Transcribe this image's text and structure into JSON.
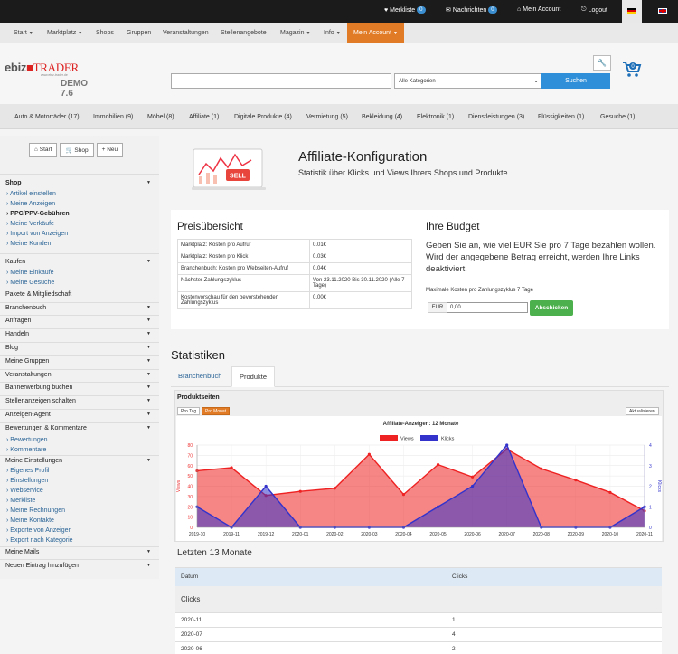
{
  "topbar": {
    "merkliste": "Merkliste",
    "merkliste_count": "0",
    "nachrichten": "Nachrichten",
    "nachrichten_count": "0",
    "account": "Mein Account",
    "logout": "Logout"
  },
  "nav": {
    "items": [
      "Start",
      "Marktplatz",
      "Shops",
      "Gruppen",
      "Veranstaltungen",
      "Stellenangebote",
      "Magazin",
      "Info"
    ],
    "active": "Mein Account"
  },
  "logo": {
    "brand1": "ebiz",
    "brand2": "TRADER",
    "url": "www.ebiz-trader.de",
    "demo": "DEMO 7.6"
  },
  "search": {
    "placeholder": "",
    "category": "Alle Kategorien",
    "button": "Suchen"
  },
  "categories": [
    "Auto & Motorräder (17)",
    "Immobilien (9)",
    "Möbel (8)",
    "Affiliate (1)",
    "Digitale Produkte (4)",
    "Vermietung (5)",
    "Bekleidung (4)",
    "Elektronik (1)",
    "Dienstleistungen (3)",
    "Flüssigkeiten (1)",
    "Gesuche (1)"
  ],
  "sidebar": {
    "buttons": {
      "start": "Start",
      "shop": "Shop",
      "neu": "Neu"
    },
    "shop": "Shop",
    "shop_links": [
      "Artikel einstellen",
      "Meine Anzeigen",
      "PPC/PPV-Gebühren",
      "Meine Verkäufe",
      "Import von Anzeigen",
      "Meine Kunden"
    ],
    "kaufen": "Kaufen",
    "kaufen_links": [
      "Meine Einkäufe",
      "Meine Gesuche"
    ],
    "sections1": [
      "Pakete & Mitgliedschaft",
      "Branchenbuch",
      "Anfragen",
      "Handeln",
      "Blog",
      "Meine Gruppen",
      "Veranstaltungen",
      "Bannerwerbung buchen",
      "Stellenanzeigen schalten",
      "Anzeigen-Agent",
      "Bewertungen & Kommentare"
    ],
    "bewertungen_links": [
      "Bewertungen",
      "Kommentare"
    ],
    "einstellungen": "Meine Einstellungen",
    "einstellungen_links": [
      "Eigenes Profil",
      "Einstellungen",
      "Webservice",
      "Merkliste",
      "Meine Rechnungen",
      "Meine Kontakte",
      "Exporte von Anzeigen",
      "Export nach Kategorie"
    ],
    "mails": "Meine Mails",
    "neuer_eintrag": "Neuen Eintrag hinzufügen"
  },
  "hero": {
    "title": "Affiliate-Konfiguration",
    "subtitle": "Statistik über Klicks und Views Ihrers Shops und Produkte",
    "img_label": "SELL"
  },
  "prices": {
    "title": "Preisübersicht",
    "rows": [
      [
        "Marktplatz: Kosten pro Aufruf",
        "0.01€"
      ],
      [
        "Marktplatz: Kosten pro Klick",
        "0.03€"
      ],
      [
        "Branchenbuch: Kosten pro Webseiten-Aufruf",
        "0.04€"
      ],
      [
        "Nächster Zahlungszyklus",
        "Von 23.11.2020 Bis 30.11.2020 (Alle 7 Tage)"
      ],
      [
        "Kostenvorschau für den bevorstehenden Zahlungszyklus",
        "0.00€"
      ]
    ]
  },
  "budget": {
    "title": "Ihre Budget",
    "text": "Geben Sie an, wie viel EUR Sie pro 7 Tage bezahlen wollen. Wird der angegebene Betrag erreicht, werden Ihre Links deaktiviert.",
    "label": "Maximale Kosten pro Zahlungszyklus 7 Tage",
    "currency": "EUR",
    "value": "0,00",
    "button": "Abschicken"
  },
  "stats": {
    "title": "Statistiken",
    "tabs": [
      "Branchenbuch",
      "Produkte"
    ],
    "box_title": "Produktseiten",
    "period_buttons": [
      "Pro Tag",
      "Pro Monat"
    ],
    "refresh": "Aktualisieren"
  },
  "chart_data": {
    "type": "area",
    "title": "Affiliate-Anzeigen: 12 Monate",
    "ylabel": "Views",
    "y2label": "Klicks",
    "x": [
      "2019-10",
      "2019-11",
      "2019-12",
      "2020-01",
      "2020-02",
      "2020-03",
      "2020-04",
      "2020-05",
      "2020-06",
      "2020-07",
      "2020-08",
      "2020-09",
      "2020-10",
      "2020-11"
    ],
    "ylim": [
      0,
      80
    ],
    "y2lim": [
      0,
      4
    ],
    "yticks": [
      "0",
      "10",
      "20",
      "30",
      "40",
      "50",
      "60",
      "70",
      "80"
    ],
    "y2ticks": [
      "0",
      "1",
      "2",
      "3",
      "4"
    ],
    "series": [
      {
        "name": "Views",
        "axis": "left",
        "color": "#ee2222",
        "values": [
          55,
          58,
          31,
          35,
          38,
          71,
          32,
          61,
          49,
          76,
          57,
          46,
          34,
          16
        ]
      },
      {
        "name": "Klicks",
        "axis": "right",
        "color": "#3333cc",
        "values": [
          1,
          0,
          2,
          0,
          0,
          0,
          0,
          1,
          2,
          4,
          0,
          0,
          0,
          1
        ]
      }
    ],
    "legend": "top"
  },
  "last": {
    "title": "Letzten 13 Monate",
    "headers": [
      "Datum",
      "Clicks"
    ],
    "section": "Clicks",
    "rows": [
      [
        "2020-11",
        "1"
      ],
      [
        "2020-07",
        "4"
      ],
      [
        "2020-06",
        "2"
      ]
    ]
  }
}
